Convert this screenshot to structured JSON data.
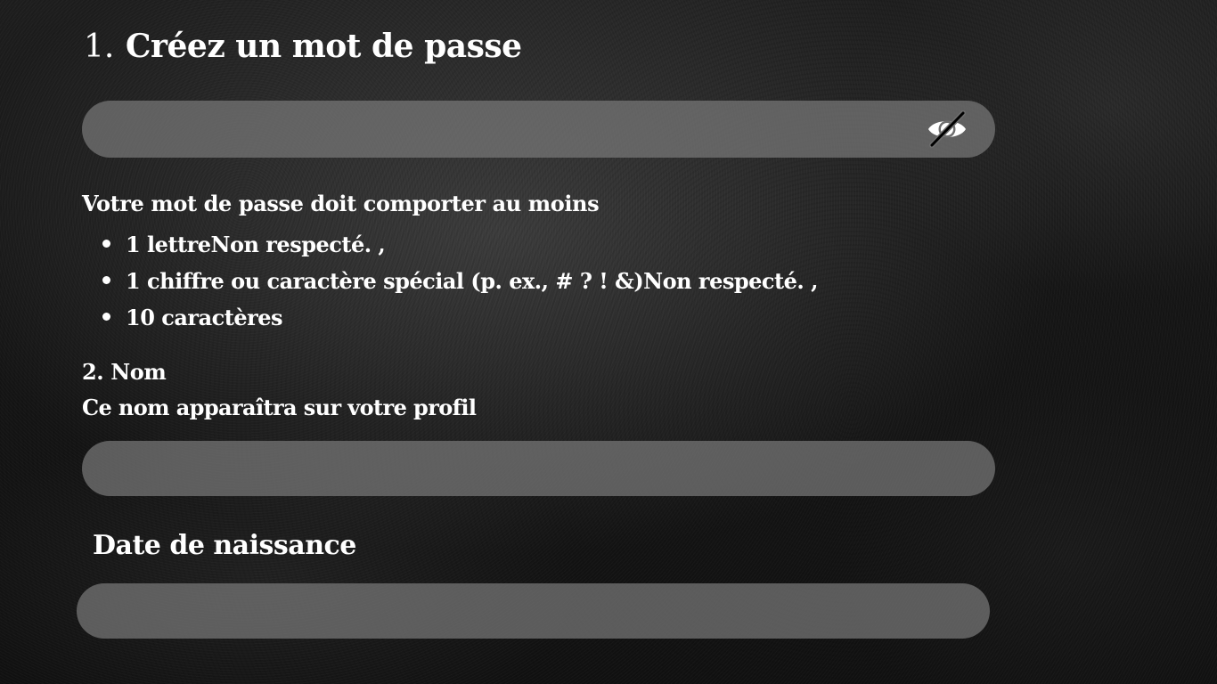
{
  "password_section": {
    "step_number": "1.",
    "title": "Créez un mot de passe",
    "input_value": "",
    "visibility_icon": "eye-slash-icon",
    "requirements_intro": "Votre mot de passe doit comporter au moins",
    "requirements": [
      {
        "text": "1 lettreNon respecté. ,"
      },
      {
        "text": "1 chiffre ou caractère spécial (p. ex., # ? ! &)Non respecté. ,"
      },
      {
        "text": "10 caractères"
      }
    ]
  },
  "name_section": {
    "title": "2. Nom",
    "help_text": "Ce nom apparaîtra sur votre profil",
    "input_value": ""
  },
  "birthdate_section": {
    "title": "Date de naissance",
    "input_value": ""
  },
  "colors": {
    "text": "#ffffff",
    "field_background": "#787878",
    "page_background": "#1a1a1a"
  }
}
